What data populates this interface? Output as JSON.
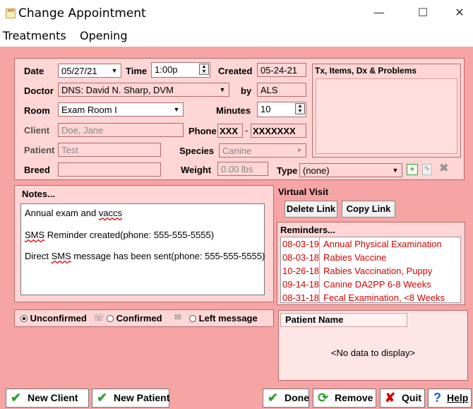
{
  "window": {
    "title": "Change Appointment",
    "logo_text": "AVI",
    "minimize": "—",
    "maximize": "☐",
    "close": "✕"
  },
  "menu": [
    "Treatments",
    "Opening"
  ],
  "form": {
    "date_label": "Date",
    "date_value": "05/27/21",
    "time_label": "Time",
    "time_value": "1:00p",
    "created_label": "Created",
    "created_value": "05-24-21",
    "doctor_label": "Doctor",
    "doctor_value": "DNS: David N. Sharp, DVM",
    "by_label": "by",
    "by_value": "ALS",
    "room_label": "Room",
    "room_value": "Exam Room I",
    "minutes_label": "Minutes",
    "minutes_value": "10",
    "client_label": "Client",
    "client_value": "Doe, Jane",
    "phone_label": "Phone",
    "phone_area": "XXX",
    "phone_dash": "-",
    "phone_number": "XXXXXXX",
    "patient_label": "Patient",
    "patient_value": "Test",
    "species_label": "Species",
    "species_value": "Canine",
    "breed_label": "Breed",
    "breed_value": "",
    "weight_label": "Weight",
    "weight_value": "0.00 lbs",
    "type_label": "Type",
    "type_value": "(none)"
  },
  "tx_panel": {
    "title": "Tx, Items, Dx & Problems"
  },
  "notes": {
    "title": "Notes...",
    "line1_a": "Annual exam and ",
    "line1_b": "vaccs",
    "line2_a": "SMS",
    "line2_b": " Reminder created(phone: 555-555-5555)",
    "line3_a": "Direct ",
    "line3_b": "SMS",
    "line3_c": " message has been sent(phone: 555-555-5555)"
  },
  "virtual_visit": {
    "title": "Virtual Visit",
    "delete_link": "Delete Link",
    "copy_link": "Copy Link"
  },
  "reminders": {
    "title": "Reminders...",
    "items": [
      {
        "date": "08-03-19",
        "text": "Annual Physical Examination"
      },
      {
        "date": "08-03-18",
        "text": "Rabies Vaccine"
      },
      {
        "date": "10-26-18",
        "text": "Rabies Vaccination, Puppy"
      },
      {
        "date": "09-14-18",
        "text": "Canine DA2PP 6-8 Weeks"
      },
      {
        "date": "08-31-18",
        "text": "Fecal Examination, <8 Weeks"
      }
    ]
  },
  "confirmation": {
    "unconfirmed": "Unconfirmed",
    "confirmed": "Confirmed",
    "left_message": "Left message",
    "selected": "Unconfirmed"
  },
  "patient_name": {
    "header": "Patient Name",
    "empty_text": "<No data to display>"
  },
  "buttons": {
    "new_client": "New Client",
    "new_patient": "New Patient",
    "done": "Done",
    "remove": "Remove",
    "quit": "Quit",
    "help": "Help"
  },
  "colors": {
    "background": "#f7a4a4",
    "panel": "#ffd6d6",
    "reminder_text": "#d40000",
    "check_green": "#2e9e2e",
    "quit_red": "#d40000",
    "help_blue": "#1f5fc9"
  }
}
